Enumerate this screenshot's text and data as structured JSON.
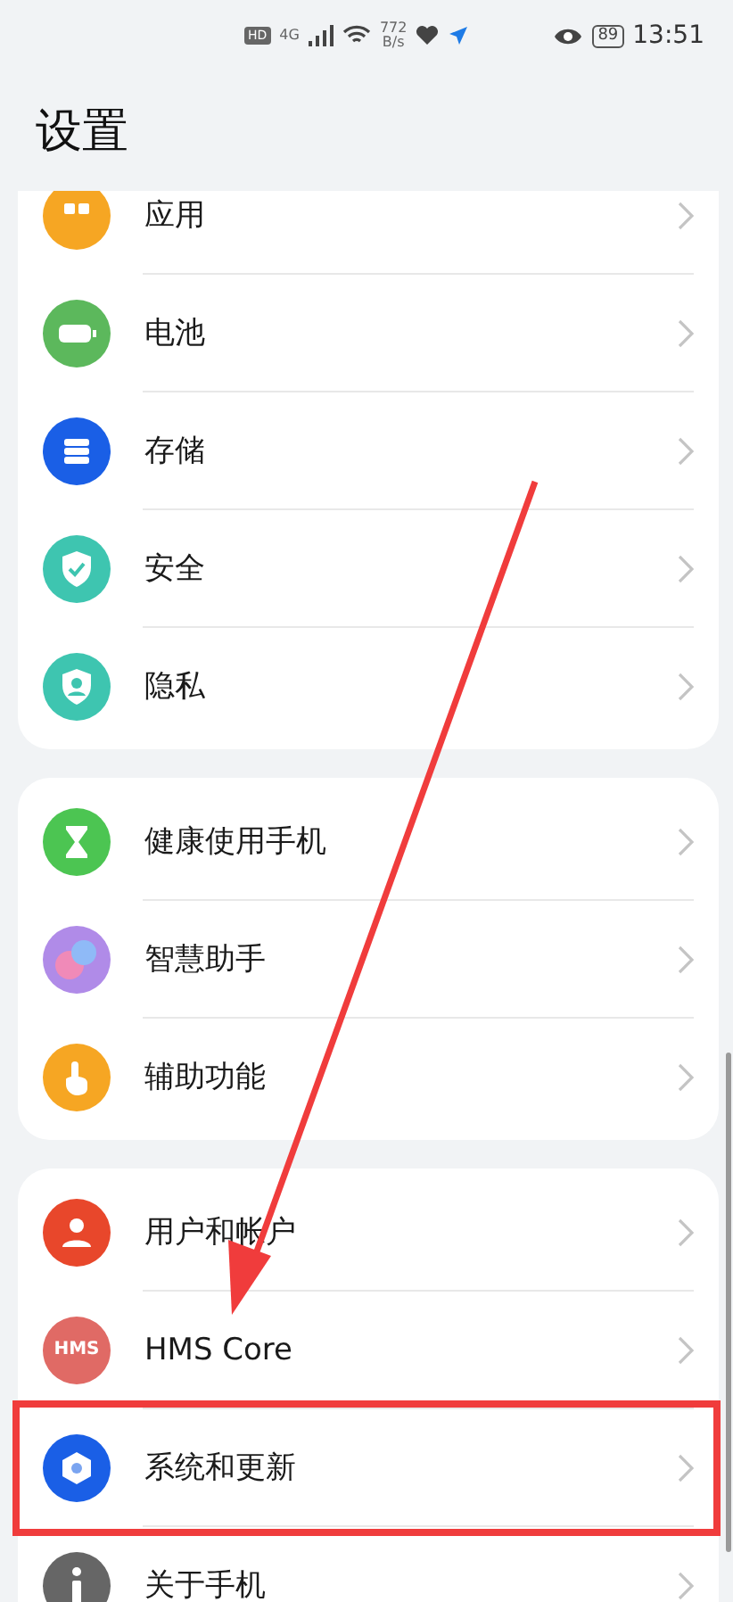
{
  "status_bar": {
    "hd": "HD",
    "network": "4G",
    "speed_value": "772",
    "speed_unit": "B/s",
    "battery": "89",
    "time": "13:51"
  },
  "title": "设置",
  "sections": [
    {
      "items": [
        {
          "label": "应用",
          "color": "#f6a623",
          "highlighted": false
        },
        {
          "label": "电池",
          "color": "#5cb85c",
          "highlighted": false
        },
        {
          "label": "存储",
          "color": "#1a5fe6",
          "highlighted": false
        },
        {
          "label": "安全",
          "color": "#3ec5b0",
          "highlighted": false
        },
        {
          "label": "隐私",
          "color": "#3ec5b0",
          "highlighted": false
        }
      ]
    },
    {
      "items": [
        {
          "label": "健康使用手机",
          "color": "#4cc552",
          "highlighted": false
        },
        {
          "label": "智慧助手",
          "color": "#b08be8",
          "highlighted": false
        },
        {
          "label": "辅助功能",
          "color": "#f6a623",
          "highlighted": false
        }
      ]
    },
    {
      "items": [
        {
          "label": "用户和帐户",
          "color": "#e8472b",
          "highlighted": false
        },
        {
          "label": "HMS Core",
          "color": "#e06a65",
          "badge": "HMS",
          "highlighted": false
        },
        {
          "label": "系统和更新",
          "color": "#1a5fe6",
          "highlighted": true
        },
        {
          "label": "关于手机",
          "color": "#666666",
          "highlighted": false
        }
      ]
    }
  ]
}
